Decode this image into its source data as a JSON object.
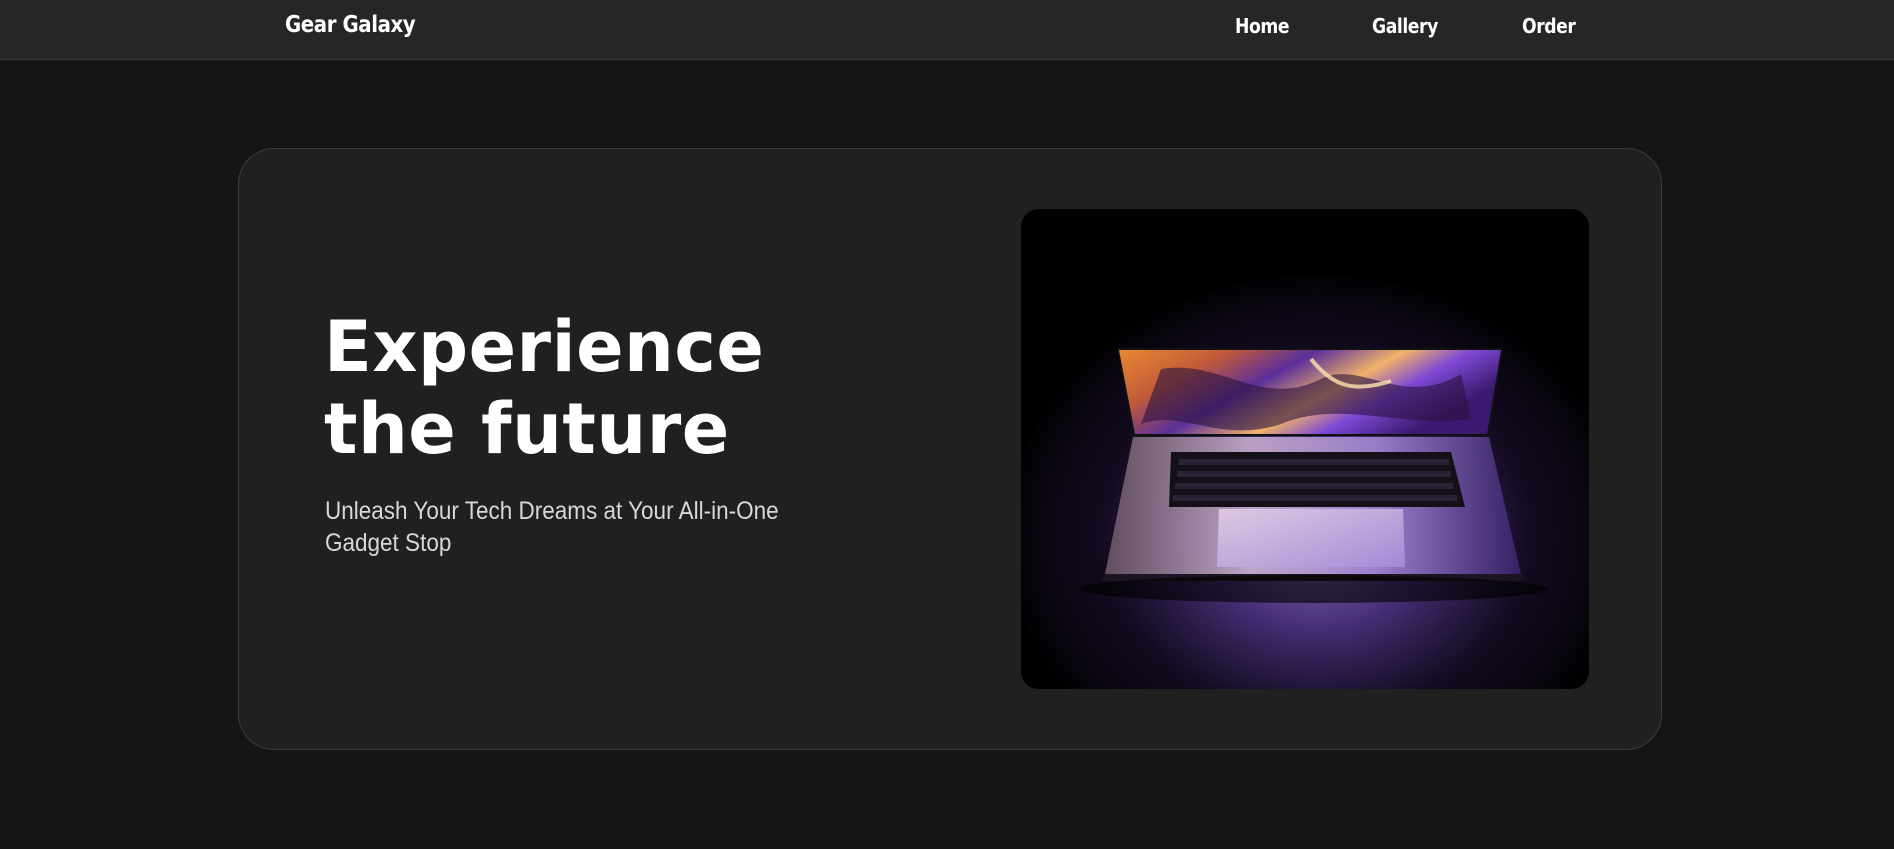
{
  "header": {
    "brand": "Gear Galaxy",
    "nav": [
      {
        "label": "Home"
      },
      {
        "label": "Gallery"
      },
      {
        "label": "Order"
      }
    ]
  },
  "hero": {
    "title_line1": "Experience",
    "title_line2": "the future",
    "subtitle": "Unleash Your Tech Dreams at Your All-in-One Gadget Stop",
    "image_alt": "laptop-photo"
  },
  "colors": {
    "page_bg": "#151515",
    "navbar_bg": "#262627",
    "card_bg": "#202021",
    "text_primary": "#ffffff",
    "text_secondary": "#d8d8d8",
    "accent_purple": "#8a4cff",
    "accent_orange": "#f08a3c"
  }
}
